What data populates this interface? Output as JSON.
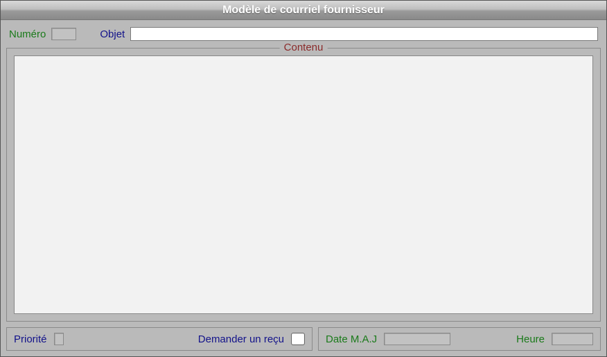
{
  "window": {
    "title": "Modèle de courriel fournisseur"
  },
  "header": {
    "numero_label": "Numéro",
    "numero_value": "",
    "objet_label": "Objet",
    "objet_value": ""
  },
  "content": {
    "legend": "Contenu",
    "body": ""
  },
  "footer": {
    "priorite_label": "Priorité",
    "priorite_value": "",
    "demander_recu_label": "Demander un reçu",
    "demander_recu_checked": false,
    "date_label": "Date M.A.J",
    "date_value": "",
    "heure_label": "Heure",
    "heure_value": ""
  }
}
